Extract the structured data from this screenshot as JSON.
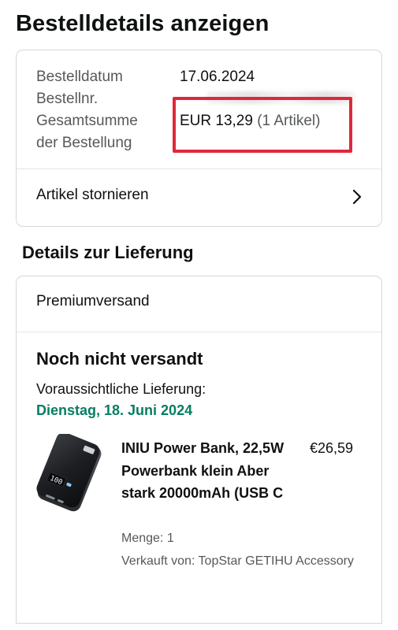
{
  "page": {
    "title": "Bestelldetails anzeigen"
  },
  "order_summary": {
    "date_label": "Bestelldatum",
    "date_value": "17.06.2024",
    "number_label": "Bestellnr.",
    "total_label_line1": "Gesamtsumme",
    "total_label_line2": "der Bestellung",
    "total_value": "EUR 13,29",
    "total_item_count": "(1 Artikel)",
    "highlight_color": "#e0283a"
  },
  "cancel": {
    "label": "Artikel stornieren",
    "icon": "chevron-right-icon"
  },
  "delivery": {
    "section_title": "Details zur Lieferung",
    "shipping_speed": "Premiumversand",
    "status": "Noch nicht versandt",
    "eta_label": "Voraussichtliche Lieferung:",
    "eta_date": "Dienstag, 18. Juni 2024",
    "eta_color": "#067d62"
  },
  "item": {
    "title": "INIU Power Bank, 22,5W Powerbank klein Aber stark 20000mAh (USB C",
    "price": "€26,59",
    "quantity": "Menge: 1",
    "seller": "Verkauft von: TopStar GETIHU Accessory",
    "image": "power-bank-product-image"
  }
}
